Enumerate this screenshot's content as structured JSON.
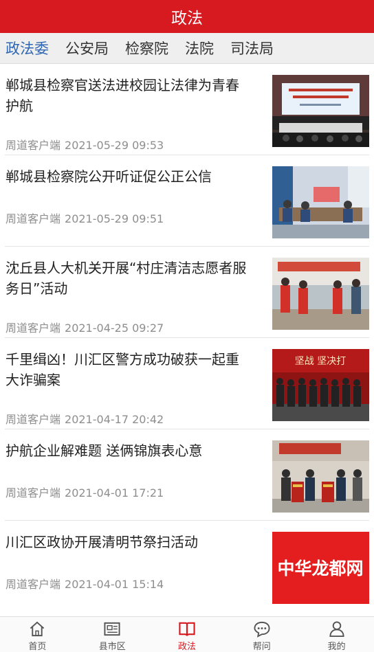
{
  "header": {
    "title": "政法"
  },
  "tabs": [
    {
      "label": "政法委",
      "active": true
    },
    {
      "label": "公安局",
      "active": false
    },
    {
      "label": "检察院",
      "active": false
    },
    {
      "label": "法院",
      "active": false
    },
    {
      "label": "司法局",
      "active": false
    }
  ],
  "articles": [
    {
      "title": "郸城县检察官送法进校园让法律为青春护航",
      "source": "周道客户端",
      "date": "2021-05-29 09:53",
      "image": "meeting-hall-photo"
    },
    {
      "title": "郸城县检察院公开听证促公正公信",
      "source": "周道客户端",
      "date": "2021-05-29 09:51",
      "image": "hearing-room-photo"
    },
    {
      "title": "沈丘县人大机关开展“村庄清洁志愿者服务日”活动",
      "source": "周道客户端",
      "date": "2021-04-25 09:27",
      "image": "volunteers-outdoor-photo"
    },
    {
      "title": "千里缉凶！川汇区警方成功破获一起重大诈骗案",
      "source": "周道客户端",
      "date": "2021-04-17 20:42",
      "image": "police-group-photo",
      "image_text": "坚战 坚决打"
    },
    {
      "title": "护航企业解难题 送俩锦旗表心意",
      "source": "周道客户端",
      "date": "2021-04-01 17:21",
      "image": "banner-presentation-photo"
    },
    {
      "title": "川汇区政协开展清明节祭扫活动",
      "source": "周道客户端",
      "date": "2021-04-01 15:14",
      "image": "logo-image",
      "image_text": "中华龙都网"
    }
  ],
  "bottom_nav": [
    {
      "label": "首页",
      "icon": "home-icon",
      "active": false
    },
    {
      "label": "县市区",
      "icon": "newspaper-icon",
      "active": false
    },
    {
      "label": "政法",
      "icon": "book-icon",
      "active": true
    },
    {
      "label": "帮问",
      "icon": "chat-bubble-icon",
      "active": false
    },
    {
      "label": "我的",
      "icon": "user-icon",
      "active": false
    }
  ],
  "colors": {
    "brand_red": "#d71920",
    "active_tab_blue": "#2f66b3",
    "meta_gray": "#8e8e8e"
  }
}
